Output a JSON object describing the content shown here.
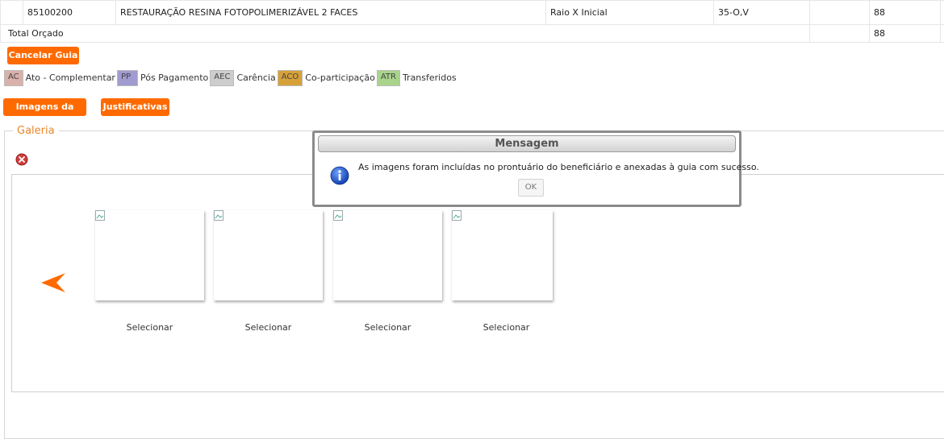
{
  "table": {
    "row": {
      "code": "85100200",
      "procedure": "RESTAURAÇÃO RESINA FOTOPOLIMERIZÁVEL 2 FACES",
      "type": "Raio X Inicial",
      "tooth": "35-O,V",
      "value": "88"
    },
    "total": {
      "label": "Total Orçado",
      "value": "88"
    }
  },
  "buttons": {
    "cancel": "Cancelar Guia",
    "images": "Imagens da Guia",
    "justifications": "Justificativas"
  },
  "legend": [
    {
      "code": "AC",
      "label": "Ato - Complementar",
      "color": "#d9b1ac"
    },
    {
      "code": "PP",
      "label": "Pós Pagamento",
      "color": "#a09bd0"
    },
    {
      "code": "AEC",
      "label": "Carência",
      "color": "#cdcdcd"
    },
    {
      "code": "ACO",
      "label": "Co-participação",
      "color": "#d7a13a"
    },
    {
      "code": "ATR",
      "label": "Transferidos",
      "color": "#a9d48c"
    }
  ],
  "gallery": {
    "title": "Galeria",
    "select_label": "Selecionar"
  },
  "modal": {
    "title": "Mensagem",
    "message": "As imagens foram incluídas no prontuário do beneficiário e anexadas à guia com sucesso.",
    "ok": "OK"
  },
  "icons": {
    "close": "close-icon",
    "info": "info-icon",
    "arrow": "arrow-left-icon",
    "broken_image": "broken-image-icon"
  },
  "colors": {
    "accent": "#ff6a00",
    "legend_title": "#e8872a"
  }
}
